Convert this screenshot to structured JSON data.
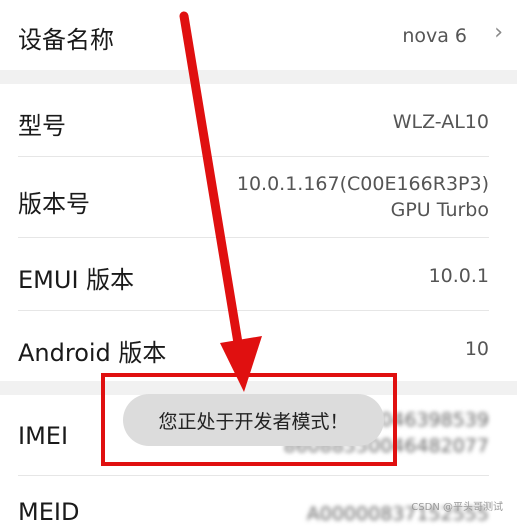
{
  "rows": {
    "device_name": {
      "label": "设备名称",
      "value": "nova 6"
    },
    "model": {
      "label": "型号",
      "value": "WLZ-AL10"
    },
    "build": {
      "label": "版本号",
      "value_line1": "10.0.1.167(C00E166R3P3)",
      "value_line2": "GPU Turbo"
    },
    "emui": {
      "label": "EMUI 版本",
      "value": "10.0.1"
    },
    "android": {
      "label": "Android 版本",
      "value": "10"
    },
    "imei": {
      "label": "IMEI",
      "value_line1": "86088550046398539",
      "value_line2": "86088550046482077"
    },
    "meid": {
      "label": "MEID",
      "value": "A00000837152555"
    }
  },
  "toast": {
    "message": "您正处于开发者模式！"
  },
  "watermark": "CSDN @平头哥测试",
  "colors": {
    "annotation_red": "#e01010",
    "toast_bg": "#dcdcdc",
    "section_gap": "#f1f1f1"
  }
}
